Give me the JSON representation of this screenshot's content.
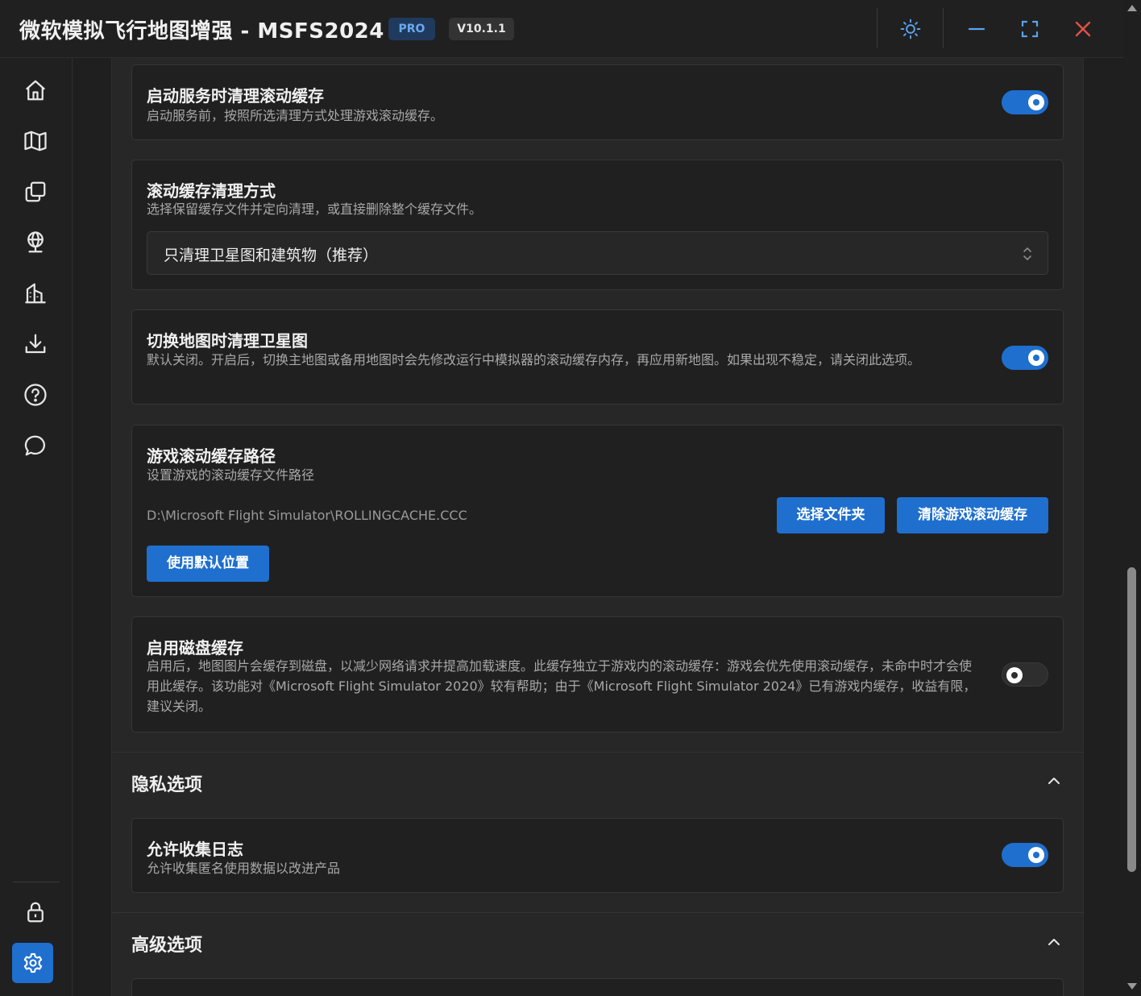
{
  "app": {
    "title": "微软模拟飞行地图增强 - MSFS2024",
    "pro_badge": "PRO",
    "version_badge": "V10.1.1"
  },
  "titlebar_icons": [
    "sun-icon",
    "minimize-icon",
    "fullscreen-icon",
    "close-icon"
  ],
  "sidebar": {
    "items": [
      "home-icon",
      "map-icon",
      "layers-icon",
      "globe-pin-icon",
      "buildings-icon",
      "download-icon",
      "help-icon",
      "chat-icon"
    ],
    "bottom_items": [
      "lock-icon",
      "settings-icon"
    ],
    "active": "settings-icon"
  },
  "cards": {
    "clear_on_start": {
      "title": "启动服务时清理滚动缓存",
      "desc": "启动服务前，按照所选清理方式处理游戏滚动缓存。",
      "enabled": true
    },
    "clear_method": {
      "title": "滚动缓存清理方式",
      "desc": "选择保留缓存文件并定向清理，或直接删除整个缓存文件。",
      "selected": "只清理卫星图和建筑物（推荐）"
    },
    "clear_on_switch": {
      "title": "切换地图时清理卫星图",
      "desc": "默认关闭。开启后，切换主地图或备用地图时会先修改运行中模拟器的滚动缓存内存，再应用新地图。如果出现不稳定，请关闭此选项。",
      "enabled": true
    },
    "cache_path": {
      "title": "游戏滚动缓存路径",
      "desc": "设置游戏的滚动缓存文件路径",
      "path": "D:\\Microsoft Flight Simulator\\ROLLINGCACHE.CCC",
      "choose_folder": "选择文件夹",
      "clear_cache": "清除游戏滚动缓存",
      "use_default": "使用默认位置"
    },
    "disk_cache": {
      "title": "启用磁盘缓存",
      "desc": "启用后，地图图片会缓存到磁盘，以减少网络请求并提高加载速度。此缓存独立于游戏内的滚动缓存：游戏会优先使用滚动缓存，未命中时才会使用此缓存。该功能对《Microsoft Flight Simulator 2020》较有帮助；由于《Microsoft Flight Simulator 2024》已有游戏内缓存，收益有限，建议关闭。",
      "enabled": false
    }
  },
  "privacy": {
    "header": "隐私选项",
    "collect_logs": {
      "title": "允许收集日志",
      "desc": "允许收集匿名使用数据以改进产品",
      "enabled": true
    }
  },
  "advanced": {
    "header": "高级选项"
  },
  "colors": {
    "accent": "#1f6fcf",
    "background": "#1f1f1f",
    "card": "#202020",
    "close": "#e0524a"
  }
}
